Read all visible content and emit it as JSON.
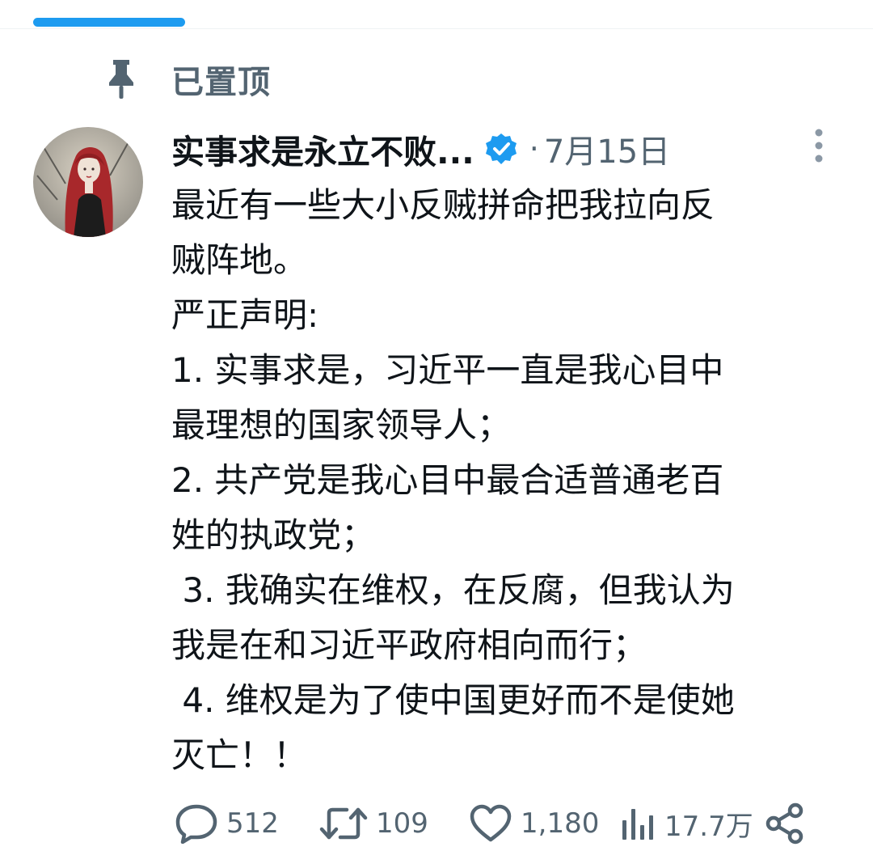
{
  "pinned": {
    "label": "已置顶"
  },
  "author": {
    "name": "实事求是永立不败...",
    "verified": true,
    "separator": "·",
    "time": "7月15日"
  },
  "tweet": {
    "lines": [
      "最近有一些大小反贼拼命把我拉向反",
      "贼阵地。",
      "严正声明:",
      "1. 实事求是，习近平一直是我心目中",
      "最理想的国家领导人；",
      "2. 共产党是我心目中最合适普通老百",
      "姓的执政党；",
      " 3. 我确实在维权，在反腐，但我认为",
      "我是在和习近平政府相向而行；",
      " 4. 维权是为了使中国更好而不是使她",
      "灭亡！！"
    ]
  },
  "actions": {
    "reply": {
      "icon": "reply-icon",
      "count": "512"
    },
    "retweet": {
      "icon": "retweet-icon",
      "count": "109"
    },
    "like": {
      "icon": "heart-icon",
      "count": "1,180"
    },
    "views": {
      "icon": "views-icon",
      "count": "17.7万"
    },
    "share": {
      "icon": "share-icon"
    }
  },
  "colors": {
    "accent": "#1d9bf0",
    "muted": "#536471",
    "text": "#0f1419"
  }
}
